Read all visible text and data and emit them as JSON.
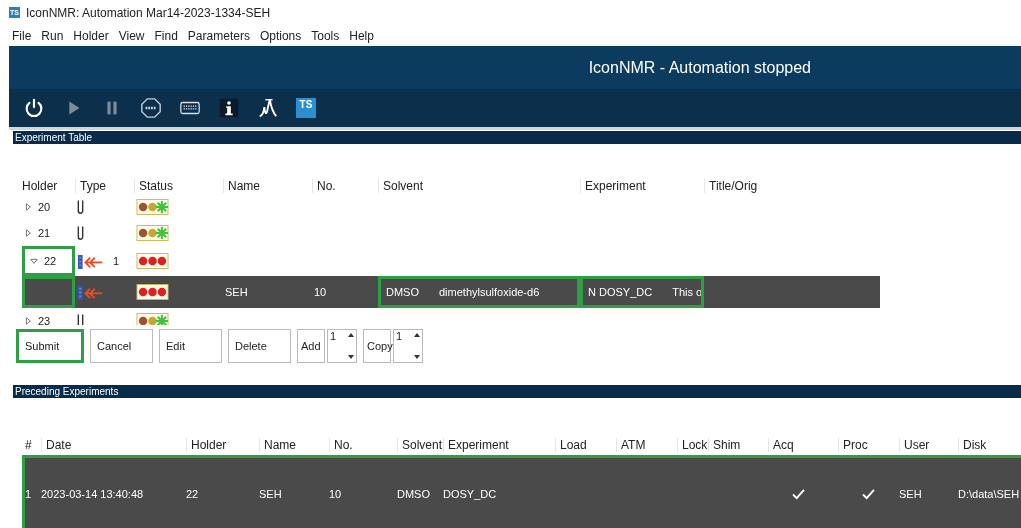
{
  "window": {
    "title": "IconNMR: Automation Mar14-2023-1334-SEH",
    "app_icon": "TS"
  },
  "menu": [
    "File",
    "Run",
    "Holder",
    "View",
    "Find",
    "Parameters",
    "Options",
    "Tools",
    "Help"
  ],
  "banner": "IconNMR - Automation stopped",
  "toolbar": [
    {
      "kind": "power",
      "disabled": false
    },
    {
      "kind": "play",
      "disabled": true
    },
    {
      "kind": "pause",
      "disabled": true
    },
    {
      "kind": "stop",
      "disabled": false
    },
    {
      "kind": "keyboard",
      "disabled": false
    },
    {
      "kind": "info",
      "disabled": false
    },
    {
      "kind": "spectrum",
      "disabled": false
    },
    {
      "kind": "ts",
      "disabled": false,
      "text": "TS"
    }
  ],
  "experiment_table": {
    "title": "Experiment Table",
    "columns": [
      "Holder",
      "Type",
      "Status",
      "Name",
      "No.",
      "Solvent",
      "Experiment",
      "Title/Orig"
    ],
    "rows": [
      {
        "kind": "holder",
        "holder": "20",
        "expanded": false,
        "type": {
          "kind": "tube"
        },
        "status": {
          "kind": "ready"
        },
        "selected": false,
        "holder_marked": false
      },
      {
        "kind": "holder",
        "holder": "21",
        "expanded": false,
        "type": {
          "kind": "tube"
        },
        "status": {
          "kind": "ready"
        },
        "selected": false,
        "holder_marked": false
      },
      {
        "kind": "holder",
        "holder": "22",
        "expanded": true,
        "type": {
          "kind": "sample"
        },
        "count": "1",
        "status": {
          "kind": "error"
        },
        "selected": false,
        "holder_marked": true
      },
      {
        "kind": "experiment",
        "type": {
          "kind": "sample"
        },
        "status": {
          "kind": "error"
        },
        "name": "SEH",
        "no": "10",
        "solvent": "DMSO",
        "solvent_full": "dimethylsulfoxide-d6",
        "experiment": "N DOSY_DC",
        "title": "This o",
        "selected": true,
        "holder_marked": true,
        "solvent_marked": true,
        "experiment_marked": true
      },
      {
        "kind": "holder",
        "holder": "23",
        "expanded": false,
        "type": {
          "kind": "tube"
        },
        "status": {
          "kind": "ready"
        },
        "selected": false,
        "holder_marked": false
      }
    ],
    "buttons": [
      {
        "kind": "button",
        "label": "Submit",
        "marked": true
      },
      {
        "kind": "button",
        "label": "Cancel",
        "marked": false
      },
      {
        "kind": "button",
        "label": "Edit",
        "marked": false
      },
      {
        "kind": "button",
        "label": "Delete",
        "marked": false
      },
      {
        "kind": "spin",
        "label": "Add",
        "value": "1",
        "marked": false
      },
      {
        "kind": "spin",
        "label": "Copy",
        "value": "1",
        "marked": false
      }
    ]
  },
  "preceding": {
    "title": "Preceding Experiments",
    "columns": [
      "#",
      "Date",
      "Holder",
      "Name",
      "No.",
      "Solvent",
      "Experiment",
      "Load",
      "ATM",
      "Lock",
      "Shim",
      "Acq",
      "Proc",
      "User",
      "Disk"
    ],
    "rows": [
      {
        "selected": true,
        "marked": true,
        "cells": [
          {
            "text": "1"
          },
          {
            "text": "2023-03-14 13:40:48"
          },
          {
            "text": "22"
          },
          {
            "text": "SEH"
          },
          {
            "text": "10"
          },
          {
            "text": "DMSO"
          },
          {
            "text": "DOSY_DC"
          },
          null,
          null,
          null,
          null,
          {
            "check": true
          },
          {
            "check": true
          },
          {
            "text": "SEH"
          },
          {
            "text": "D:\\data\\SEH"
          }
        ]
      }
    ]
  }
}
